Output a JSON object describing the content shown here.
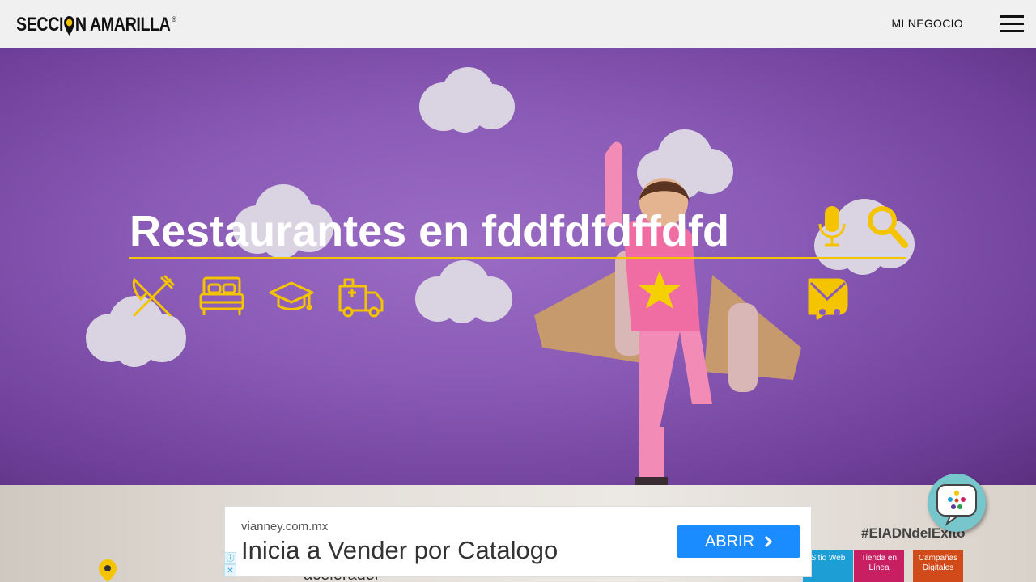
{
  "header": {
    "logo_text_1": "SECCI",
    "logo_text_2": "N AMARILLA",
    "logo_reg": "®",
    "nav_link": "MI NEGOCIO",
    "menu_icon": "hamburger-icon"
  },
  "hero": {
    "search_value": "Restaurantes en fddfdfdffdfd",
    "mic_icon": "microphone-icon",
    "search_icon": "search-icon",
    "categories": [
      {
        "icon": "fork-knife-icon"
      },
      {
        "icon": "bed-icon"
      },
      {
        "icon": "graduation-cap-icon"
      },
      {
        "icon": "ambulance-icon"
      }
    ],
    "extra_icon": "mail-icon",
    "accent": "#f5c400"
  },
  "ad": {
    "domain": "vianney.com.mx",
    "headline": "Inicia a Vender por Catalogo",
    "button": "ABRIR",
    "adchoice_info": "ⓘ",
    "adchoice_close": "✕",
    "button_color": "#1a8cff"
  },
  "bottom": {
    "hashtag": "#ElADNdelExito",
    "tiles": [
      {
        "label": "Sitio Web",
        "color": "#1d9fd6"
      },
      {
        "label": "Tienda en Línea",
        "color": "#c81f63"
      },
      {
        "label": "Campañas Digitales",
        "color": "#d14a1a"
      }
    ],
    "brand_fragment": "acelerador"
  }
}
